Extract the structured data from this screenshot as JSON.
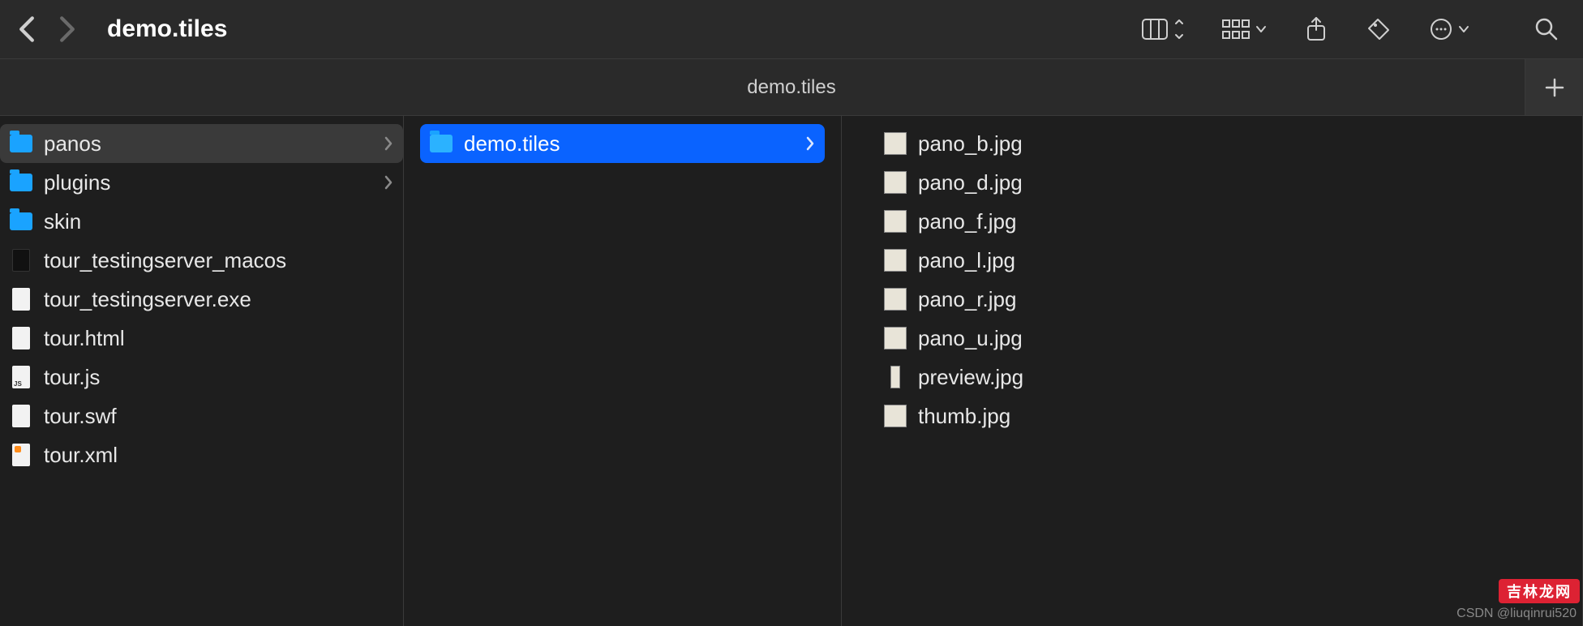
{
  "titlebar": {
    "title": "demo.tiles"
  },
  "pathbar": {
    "crumb": "demo.tiles"
  },
  "columns": {
    "col1": [
      {
        "name": "panos",
        "type": "folder",
        "chevron": true,
        "selected": "dim"
      },
      {
        "name": "plugins",
        "type": "folder",
        "chevron": true
      },
      {
        "name": "skin",
        "type": "folder"
      },
      {
        "name": "tour_testingserver_macos",
        "type": "exec"
      },
      {
        "name": "tour_testingserver.exe",
        "type": "file"
      },
      {
        "name": "tour.html",
        "type": "file"
      },
      {
        "name": "tour.js",
        "type": "js"
      },
      {
        "name": "tour.swf",
        "type": "file"
      },
      {
        "name": "tour.xml",
        "type": "xml"
      }
    ],
    "col2": [
      {
        "name": "demo.tiles",
        "type": "folder",
        "chevron": true,
        "selected": "bright"
      }
    ],
    "col3": [
      {
        "name": "pano_b.jpg",
        "type": "image"
      },
      {
        "name": "pano_d.jpg",
        "type": "image"
      },
      {
        "name": "pano_f.jpg",
        "type": "image"
      },
      {
        "name": "pano_l.jpg",
        "type": "image"
      },
      {
        "name": "pano_r.jpg",
        "type": "image"
      },
      {
        "name": "pano_u.jpg",
        "type": "image"
      },
      {
        "name": "preview.jpg",
        "type": "image-tall"
      },
      {
        "name": "thumb.jpg",
        "type": "image"
      }
    ]
  },
  "watermarks": {
    "csdn": "CSDN @liuqinrui520",
    "red": "吉林龙网"
  }
}
